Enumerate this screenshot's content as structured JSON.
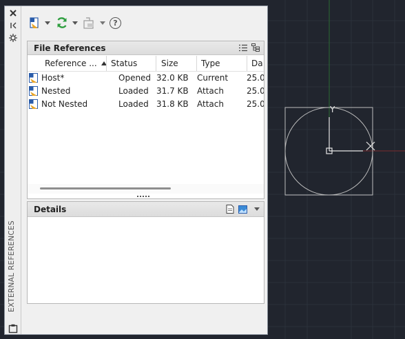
{
  "palette": {
    "title": "EXTERNAL REFERENCES"
  },
  "file_references": {
    "header": "File References",
    "columns": [
      "Reference ...",
      "Status",
      "Size",
      "Type",
      "Da"
    ],
    "rows": [
      {
        "name": "Host*",
        "status": "Opened",
        "size": "32.0 KB",
        "type": "Current",
        "date": "25.0"
      },
      {
        "name": "Nested",
        "status": "Loaded",
        "size": "31.7 KB",
        "type": "Attach",
        "date": "25.0"
      },
      {
        "name": "Not Nested",
        "status": "Loaded",
        "size": "31.8 KB",
        "type": "Attach",
        "date": "25.0"
      }
    ]
  },
  "details": {
    "header": "Details"
  },
  "drawing": {
    "ucs_y_label": "Y"
  },
  "colors": {
    "background": "#21252e",
    "palette": "#f0f0f0",
    "accent_green": "#2e9e3f",
    "axis_red": "#8a2a2a",
    "axis_green": "#2a7a2a",
    "geometry": "#c8c8c8"
  }
}
